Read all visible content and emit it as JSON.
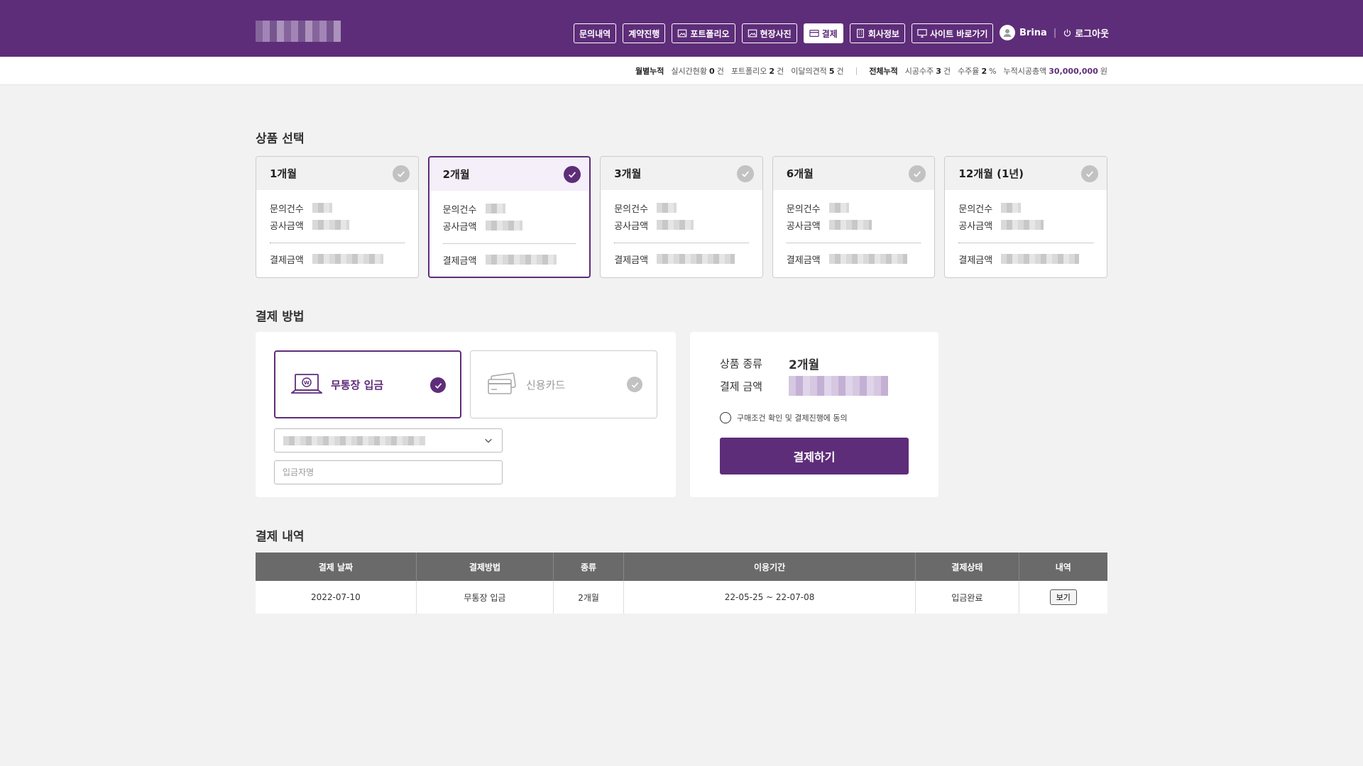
{
  "header": {
    "nav": [
      {
        "label": "문의내역",
        "icon": ""
      },
      {
        "label": "계약진행",
        "icon": ""
      },
      {
        "label": "포트폴리오",
        "icon": "image-icon"
      },
      {
        "label": "현장사진",
        "icon": "image-icon"
      },
      {
        "label": "결제",
        "icon": "card-icon",
        "active": true
      },
      {
        "label": "회사정보",
        "icon": "building-icon"
      },
      {
        "label": "사이트 바로가기",
        "icon": "monitor-icon"
      }
    ],
    "user_name": "Brina",
    "sep": "|",
    "logout_label": "로그아웃"
  },
  "stats": {
    "monthly_label": "월별누적",
    "realtime_label": "실시간현황",
    "realtime_value": "0",
    "realtime_unit": "건",
    "portfolio_label": "포트폴리오",
    "portfolio_value": "2",
    "portfolio_unit": "건",
    "estimate_label": "이달의견적",
    "estimate_value": "5",
    "estimate_unit": "건",
    "sep": "|",
    "total_label": "전체누적",
    "contracts_label": "시공수주",
    "contracts_value": "3",
    "contracts_unit": "건",
    "rate_label": "수주율",
    "rate_value": "2",
    "rate_unit": "%",
    "amount_label": "누적시공총액",
    "amount_value": "30,000,000",
    "amount_unit": "원"
  },
  "product": {
    "title": "상품 선택",
    "inquiry_label": "문의건수",
    "work_label": "공사금액",
    "pay_label": "결제금액",
    "cards": [
      {
        "name": "1개월",
        "selected": false
      },
      {
        "name": "2개월",
        "selected": true
      },
      {
        "name": "3개월",
        "selected": false
      },
      {
        "name": "6개월",
        "selected": false
      },
      {
        "name": "12개월 (1년)",
        "selected": false
      }
    ]
  },
  "payment": {
    "title": "결제 방법",
    "bank_label": "무통장 입금",
    "card_label": "신용카드",
    "depositor_placeholder": "입금자명",
    "summary": {
      "type_label": "상품 종류",
      "type_value": "2개월",
      "amount_label": "결제 금액",
      "agree_label": "구매조건 확인 및 결제진행에 동의",
      "pay_button": "결제하기"
    }
  },
  "history": {
    "title": "결제 내역",
    "columns": [
      "결제 날짜",
      "결제방법",
      "종류",
      "이용기간",
      "결제상태",
      "내역"
    ],
    "rows": [
      {
        "date": "2022-07-10",
        "method": "무통장 입금",
        "type": "2개월",
        "period": "22-05-25 ~ 22-07-08",
        "status": "입금완료",
        "action": "보기"
      }
    ]
  },
  "colors": {
    "brand": "#5e2d79",
    "table_header": "#6a6a6a"
  }
}
